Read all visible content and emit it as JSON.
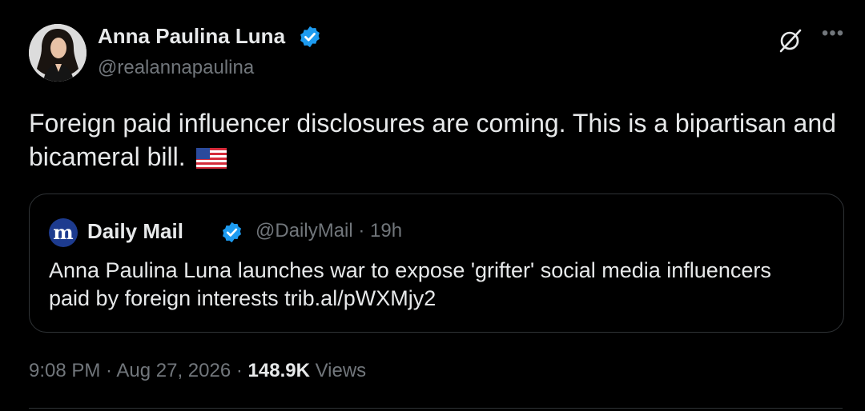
{
  "author": {
    "name": "Anna Paulina Luna",
    "handle": "@realannapaulina",
    "verified_color": "#1d9bf0"
  },
  "icons": {
    "avatar": "avatar",
    "verified": "verified-badge-icon",
    "grok": "grok-icon",
    "more": "more-options-icon",
    "flag": "us-flag-emoji"
  },
  "post": {
    "text": "Foreign paid influencer disclosures are coming. This is a bipartisan and bicameral bill."
  },
  "quote": {
    "logo_letter": "m",
    "name": "Daily Mail",
    "handle": "@DailyMail",
    "separator": " · ",
    "time": "19h",
    "text": "Anna Paulina Luna launches war to expose 'grifter' social media influencers paid by foreign interests trib.al/pWXMjy2"
  },
  "meta": {
    "time": "9:08 PM",
    "sep1": " · ",
    "date": "Aug 27, 2026",
    "sep2": " · ",
    "views_count": "148.9K",
    "views_label": " Views"
  },
  "colors": {
    "background": "#000000",
    "text": "#e7e9ea",
    "muted": "#71767b",
    "border": "#2f3336",
    "verified": "#1d9bf0"
  }
}
